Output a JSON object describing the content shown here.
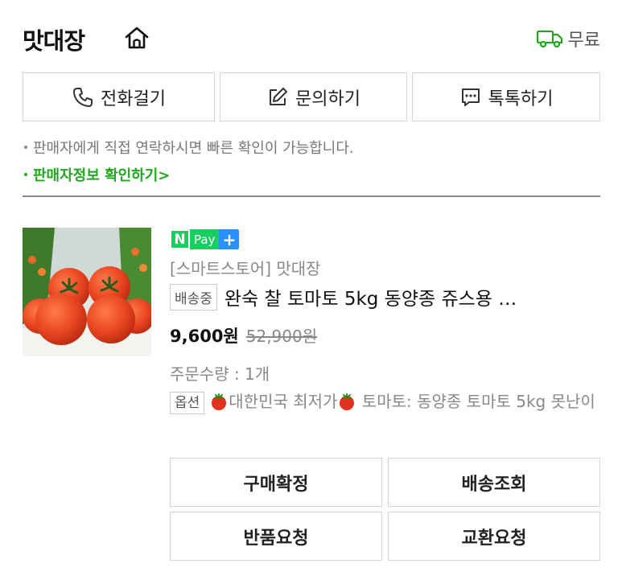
{
  "store": {
    "name": "맛대장",
    "home_icon": "home-icon",
    "shipping_icon": "truck-icon",
    "shipping_label": "무료"
  },
  "contact": {
    "call_label": "전화걸기",
    "inquiry_label": "문의하기",
    "talk_label": "톡톡하기",
    "icons": [
      "phone-icon",
      "edit-icon",
      "chat-icon"
    ]
  },
  "notice": {
    "text": "판매자에게 직접 연락하시면 빠른 확인이 가능합니다.",
    "link": "판매자정보 확인하기>"
  },
  "order": {
    "npay_n": "N",
    "npay_text": "Pay",
    "npay_plus": "+",
    "seller": "[스마트스토어] 맛대장",
    "status_badge": "배송중",
    "title": "완숙 찰 토마토 5kg 동양종 쥬스용 …",
    "price": "9,600원",
    "original_price": "52,900원",
    "quantity": "주문수량 : 1개",
    "option_badge": "옵션",
    "option_part1": "대한민국 최저가",
    "option_part2": " 토마토: 동양종 토마토 5kg 못난이",
    "image_icon": "tomato-product-image"
  },
  "actions": {
    "confirm_label": "구매확정",
    "tracking_label": "배송조회",
    "return_label": "반품요청",
    "exchange_label": "교환요청"
  },
  "colors": {
    "green_accent": "#1fa81f",
    "npay_green": "#19ce60",
    "npay_blue": "#2a90ff",
    "border": "#d4d4d4"
  }
}
